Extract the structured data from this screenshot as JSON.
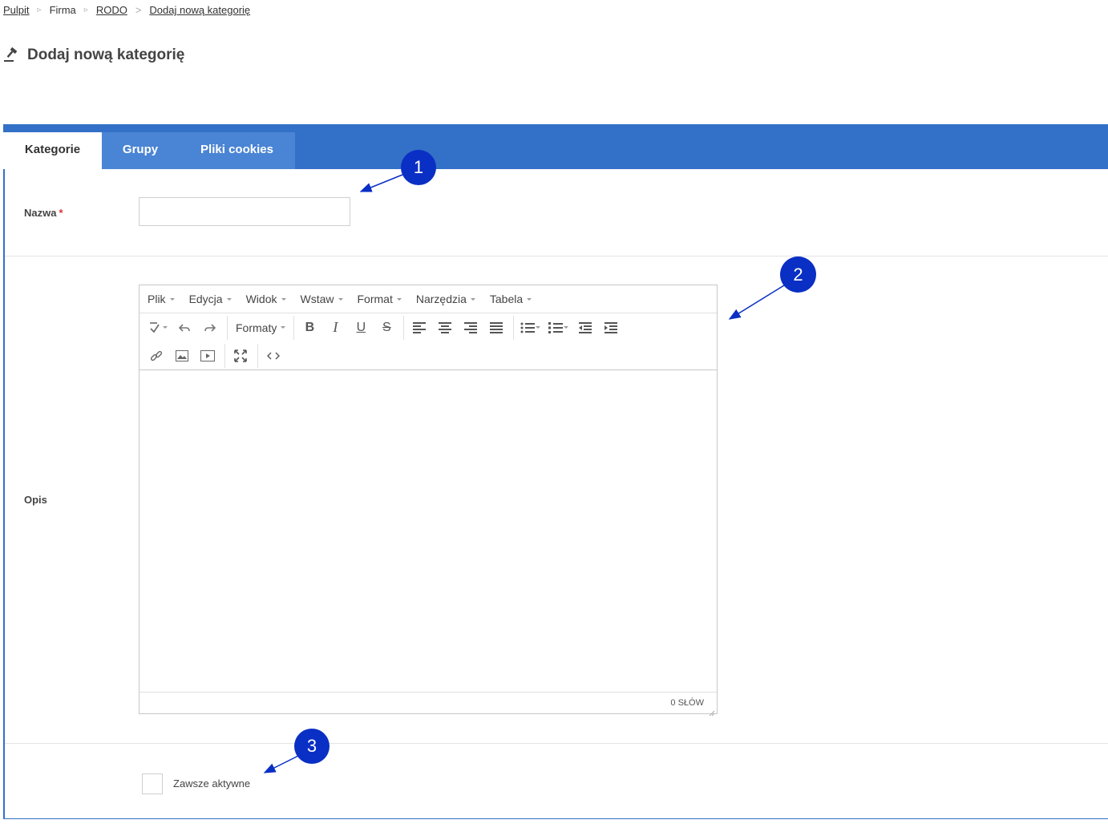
{
  "breadcrumb": {
    "items": [
      {
        "label": "Pulpit",
        "link": true
      },
      {
        "label": "Firma",
        "link": false
      },
      {
        "label": "RODO",
        "link": true
      },
      {
        "label": "Dodaj nową kategorię",
        "link": true
      }
    ]
  },
  "page": {
    "title": "Dodaj nową kategorię",
    "title_icon": "gavel-icon"
  },
  "tabs": [
    {
      "label": "Kategorie",
      "active": true
    },
    {
      "label": "Grupy",
      "active": false
    },
    {
      "label": "Pliki cookies",
      "active": false
    }
  ],
  "form": {
    "name_label": "Nazwa",
    "required_mark": "*",
    "name_value": "",
    "desc_label": "Opis",
    "always_active_label": "Zawsze aktywne",
    "always_active_checked": false
  },
  "editor": {
    "menu": [
      "Plik",
      "Edycja",
      "Widok",
      "Wstaw",
      "Format",
      "Narzędzia",
      "Tabela"
    ],
    "formats_label": "Formaty",
    "word_count": "0 SŁÓW",
    "content": ""
  },
  "annotations": [
    "1",
    "2",
    "3"
  ],
  "colors": {
    "tabbar": "#3370c7",
    "annotation": "#0a2fc4"
  }
}
